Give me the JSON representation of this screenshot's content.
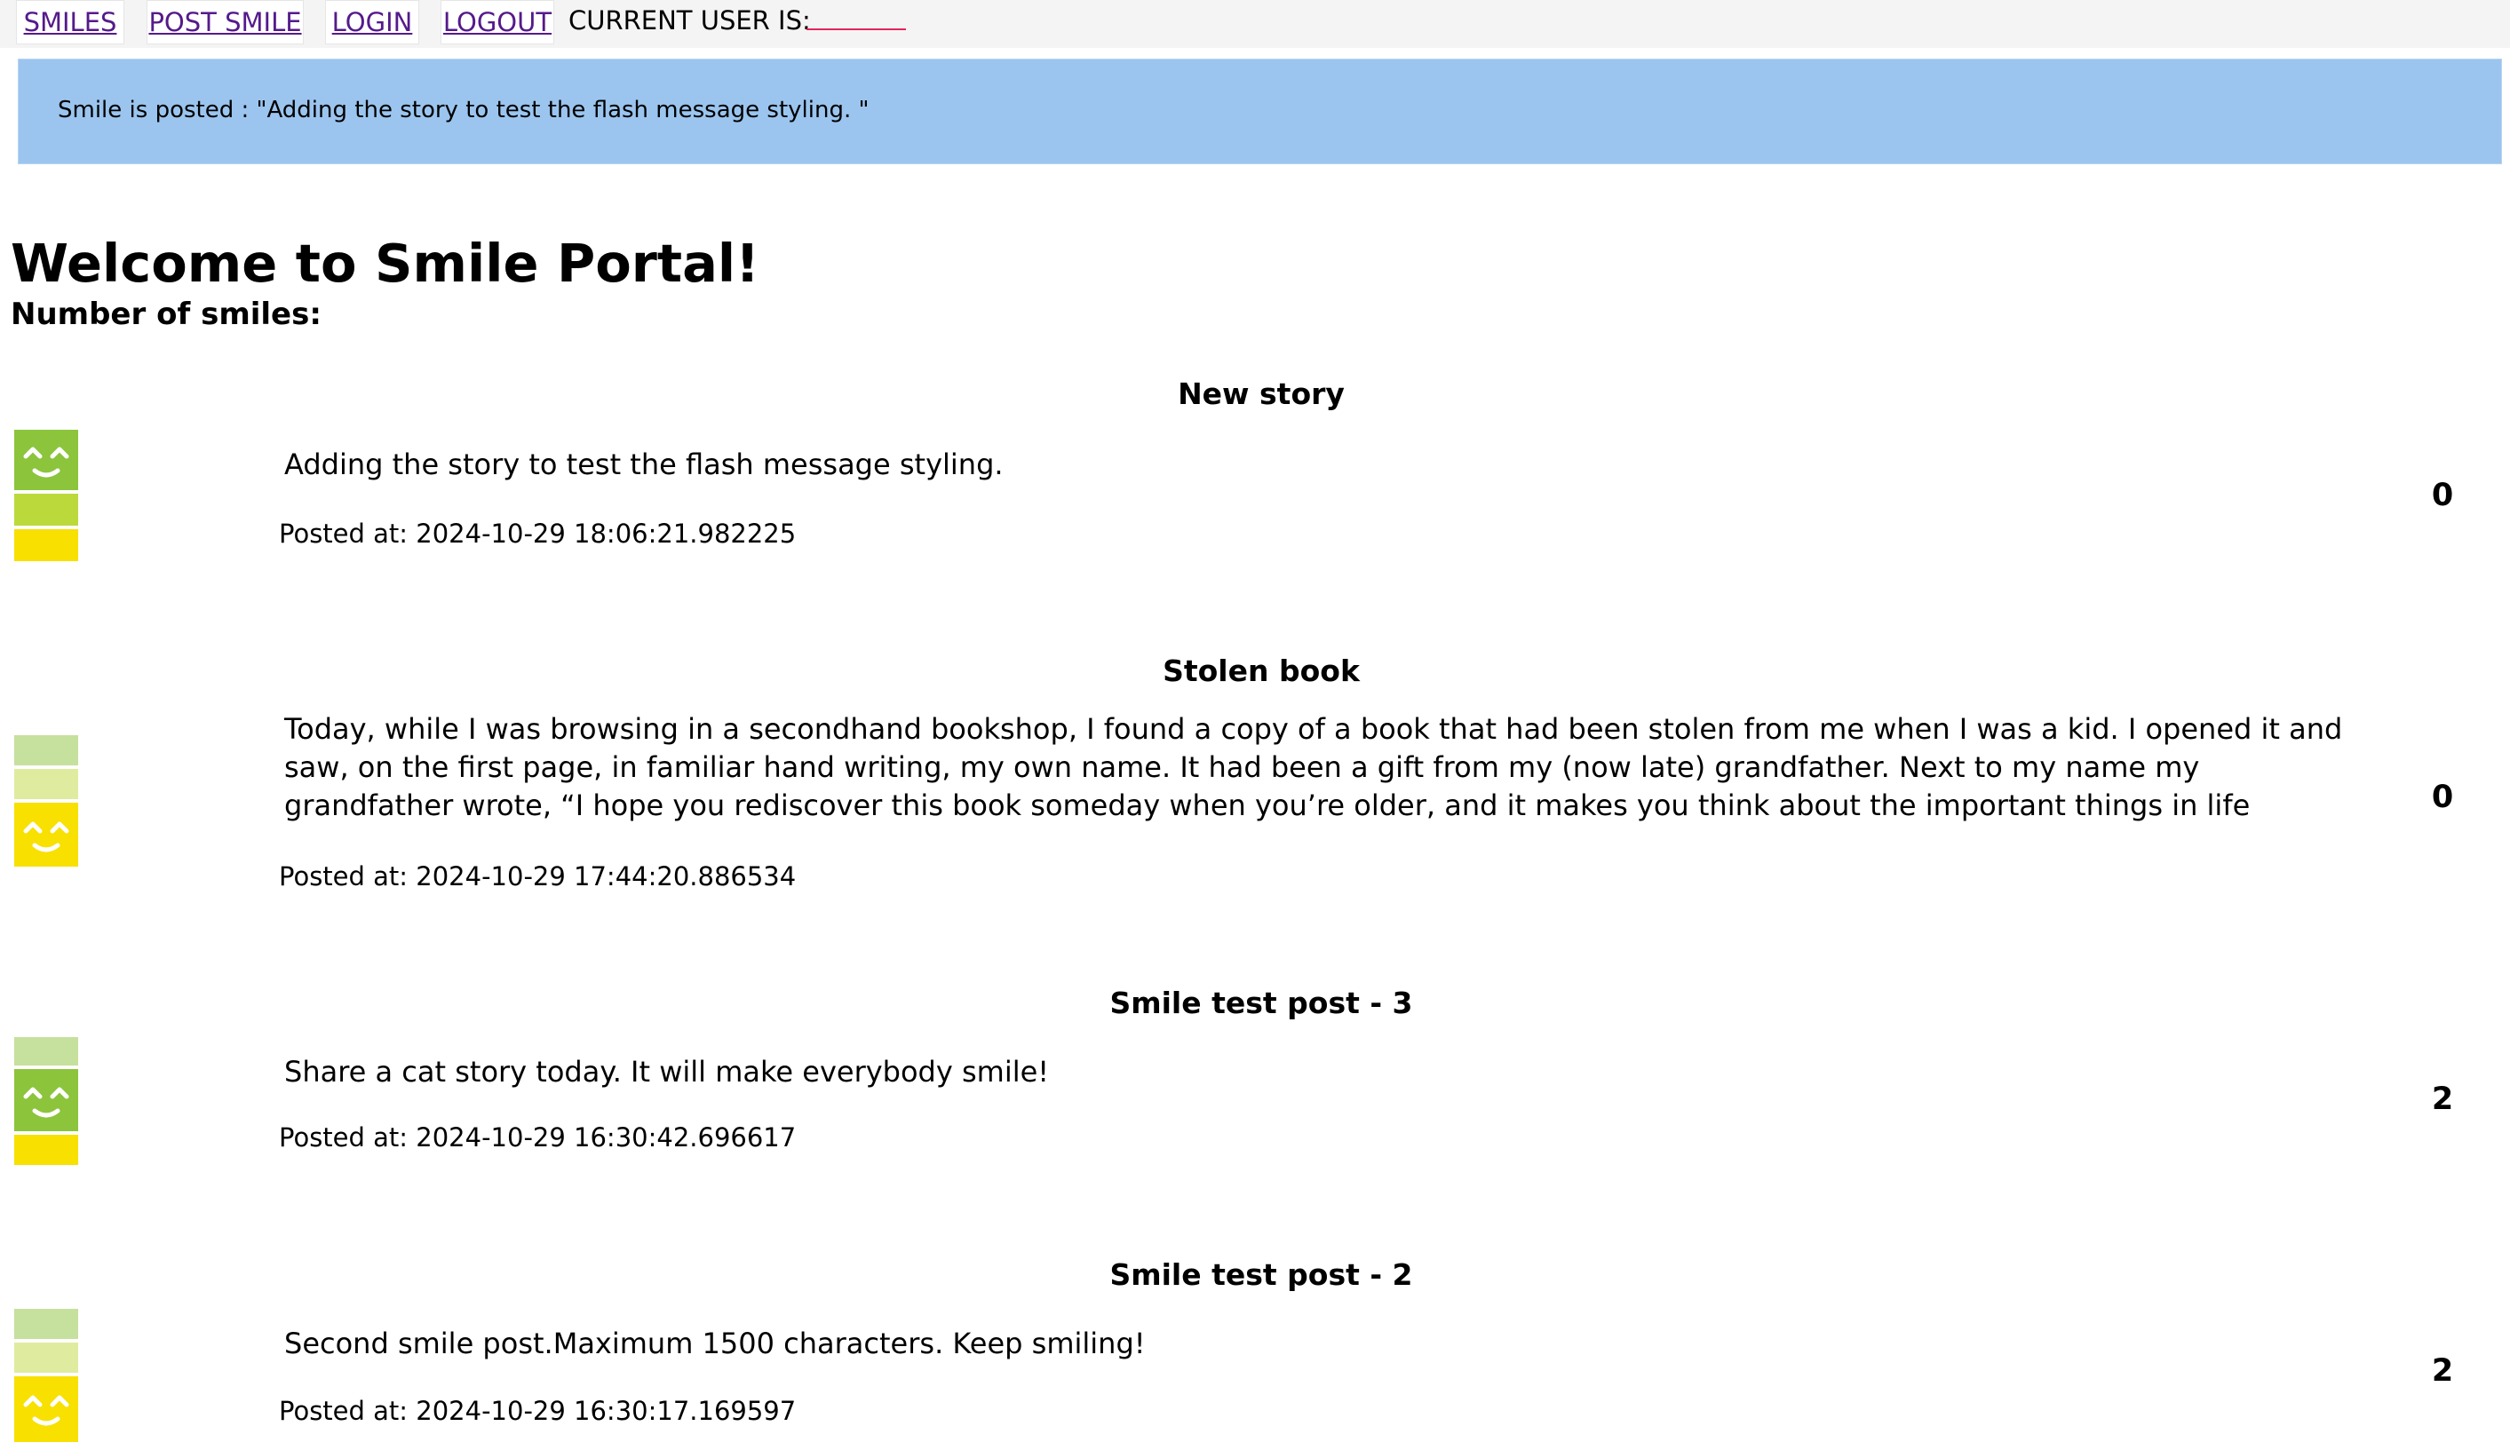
{
  "nav": {
    "smiles": "SMILES",
    "post_smile": "POST SMILE",
    "login": "LOGIN",
    "logout": "LOGOUT",
    "current_user_label": "CURRENT USER IS:"
  },
  "flash": {
    "message": "Smile is posted : \"Adding the story to test the flash message styling. \""
  },
  "page": {
    "title": "Welcome to Smile Portal!",
    "count_label": "Number of smiles:"
  },
  "posts": [
    {
      "title": "New story",
      "body": "Adding the story to test the flash message styling.",
      "posted": "Posted at: 2024-10-29 18:06:21.982225",
      "likes": "0",
      "mood": "happy-top"
    },
    {
      "title": "Stolen book",
      "body": "Today, while I was browsing in a secondhand bookshop, I found a copy of a book that had been stolen from me when I was a kid. I opened it and saw, on the first page, in familiar hand writing, my own name. It had been a gift from my (now late) grandfather. Next to my name my grandfather wrote, “I hope you rediscover this book someday when you’re older, and it makes you think about the important things in life",
      "posted": "Posted at: 2024-10-29 17:44:20.886534",
      "likes": "0",
      "mood": "smile-bottom"
    },
    {
      "title": "Smile test post - 3",
      "body": "Share a cat story today. It will make everybody smile!",
      "posted": "Posted at: 2024-10-29 16:30:42.696617",
      "likes": "2",
      "mood": "happy-middle"
    },
    {
      "title": "Smile test post - 2",
      "body": "Second smile post.Maximum 1500 characters. Keep smiling!",
      "posted": "Posted at: 2024-10-29 16:30:17.169597",
      "likes": "2",
      "mood": "smile-bottom"
    }
  ],
  "colors": {
    "nav_link": "#551a8b",
    "flash_bg": "#9bc5ef",
    "meter_green_dark": "#8cc43c",
    "meter_green_mid": "#bcd93c",
    "meter_green_light": "#c6e09e",
    "meter_green_pale": "#dfeca0",
    "meter_yellow": "#f8e000"
  }
}
